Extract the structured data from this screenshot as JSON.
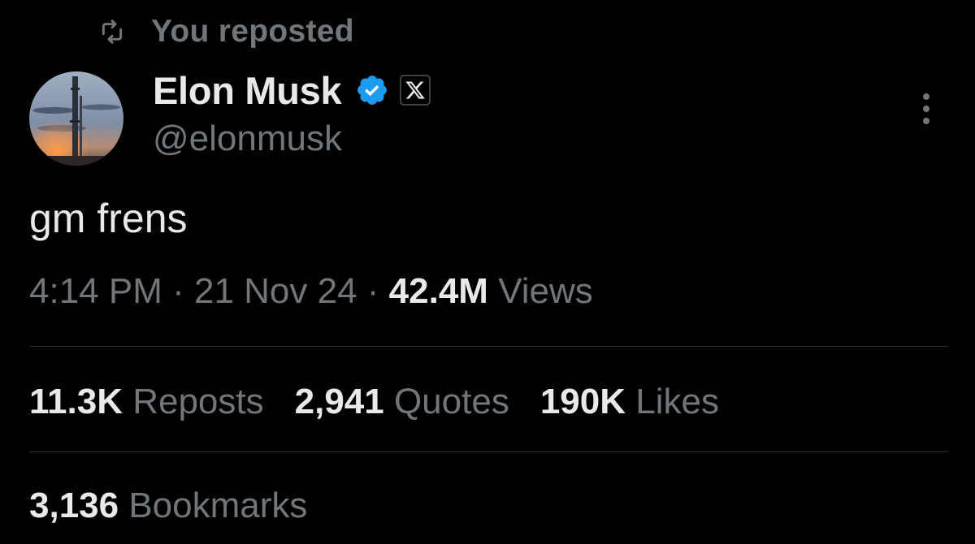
{
  "social_context": {
    "label": "You reposted",
    "icon": "repost-icon"
  },
  "author": {
    "display_name": "Elon Musk",
    "handle": "@elonmusk",
    "verified_icon": "verified-badge-icon",
    "affiliation_icon": "x-logo-icon",
    "avatar_icon": "starship-avatar"
  },
  "tweet": {
    "text": "gm frens",
    "time": "4:14 PM",
    "separator": " · ",
    "date": "21 Nov 24",
    "views_count": "42.4M",
    "views_label": " Views"
  },
  "stats": {
    "reposts_count": "11.3K",
    "reposts_label": " Reposts",
    "quotes_count": "2,941",
    "quotes_label": " Quotes",
    "likes_count": "190K",
    "likes_label": " Likes",
    "bookmarks_count": "3,136",
    "bookmarks_label": " Bookmarks"
  },
  "more_icon": "more-options-icon",
  "colors": {
    "background": "#000000",
    "primary_text": "#e7e9ea",
    "secondary_text": "#71767b",
    "divider": "#2f3336",
    "verified_blue": "#1d9bf0"
  }
}
